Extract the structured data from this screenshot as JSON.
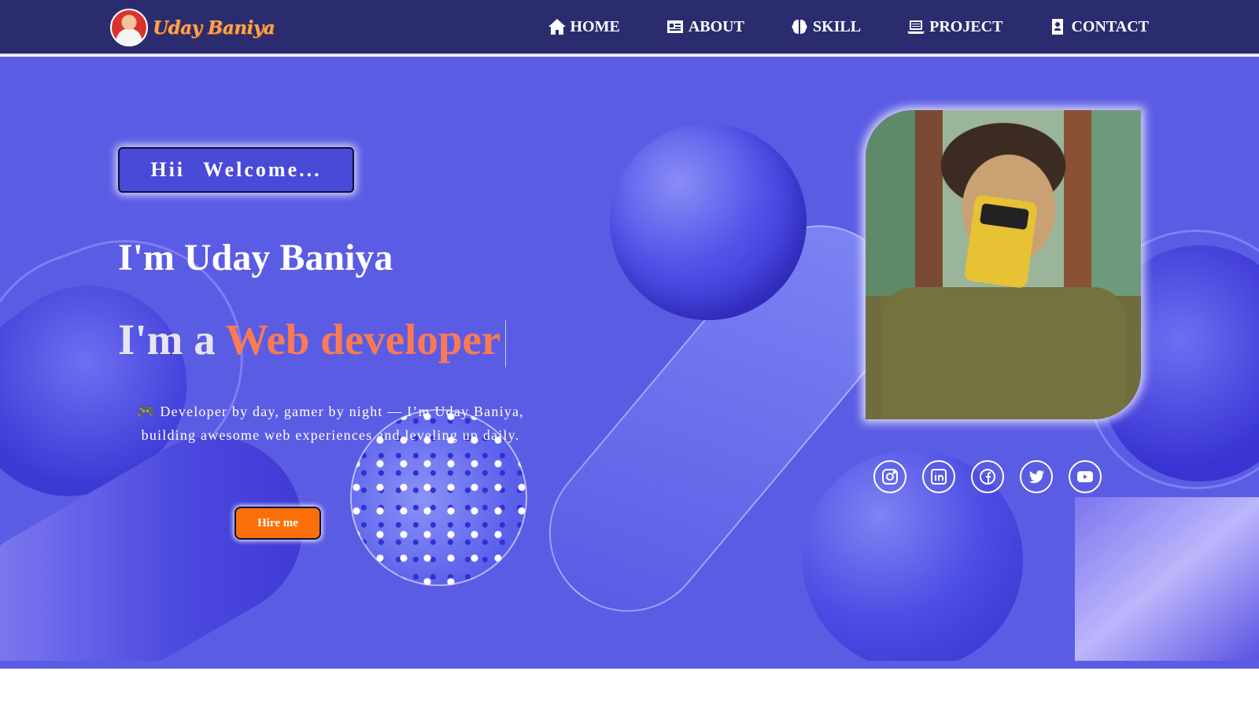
{
  "brand": {
    "name": "Uday Baniya"
  },
  "nav": {
    "items": [
      {
        "label": "HOME",
        "icon": "home-icon"
      },
      {
        "label": "ABOUT",
        "icon": "id-card-icon"
      },
      {
        "label": "SKILL",
        "icon": "brain-icon"
      },
      {
        "label": "PROJECT",
        "icon": "laptop-icon"
      },
      {
        "label": "CONTACT",
        "icon": "contact-icon"
      }
    ]
  },
  "hero": {
    "welcome": "Hii  Welcome...",
    "name": "I'm Uday Baniya",
    "role_prefix": "I'm a ",
    "role_accent": "Web developer",
    "description": "🎮 Developer by day, gamer by night — I’m Uday Baniya, building awesome web experiences and leveling up daily.",
    "cta": "Hire me"
  },
  "socials": [
    {
      "name": "instagram",
      "icon": "instagram-icon"
    },
    {
      "name": "linkedin",
      "icon": "linkedin-icon"
    },
    {
      "name": "facebook",
      "icon": "facebook-icon"
    },
    {
      "name": "twitter",
      "icon": "twitter-icon"
    },
    {
      "name": "youtube",
      "icon": "youtube-icon"
    }
  ],
  "colors": {
    "nav_bg": "#2b2c6f",
    "hero_bg": "#5b5ce4",
    "accent": "#fb7a52",
    "cta": "#fb6f0b"
  }
}
